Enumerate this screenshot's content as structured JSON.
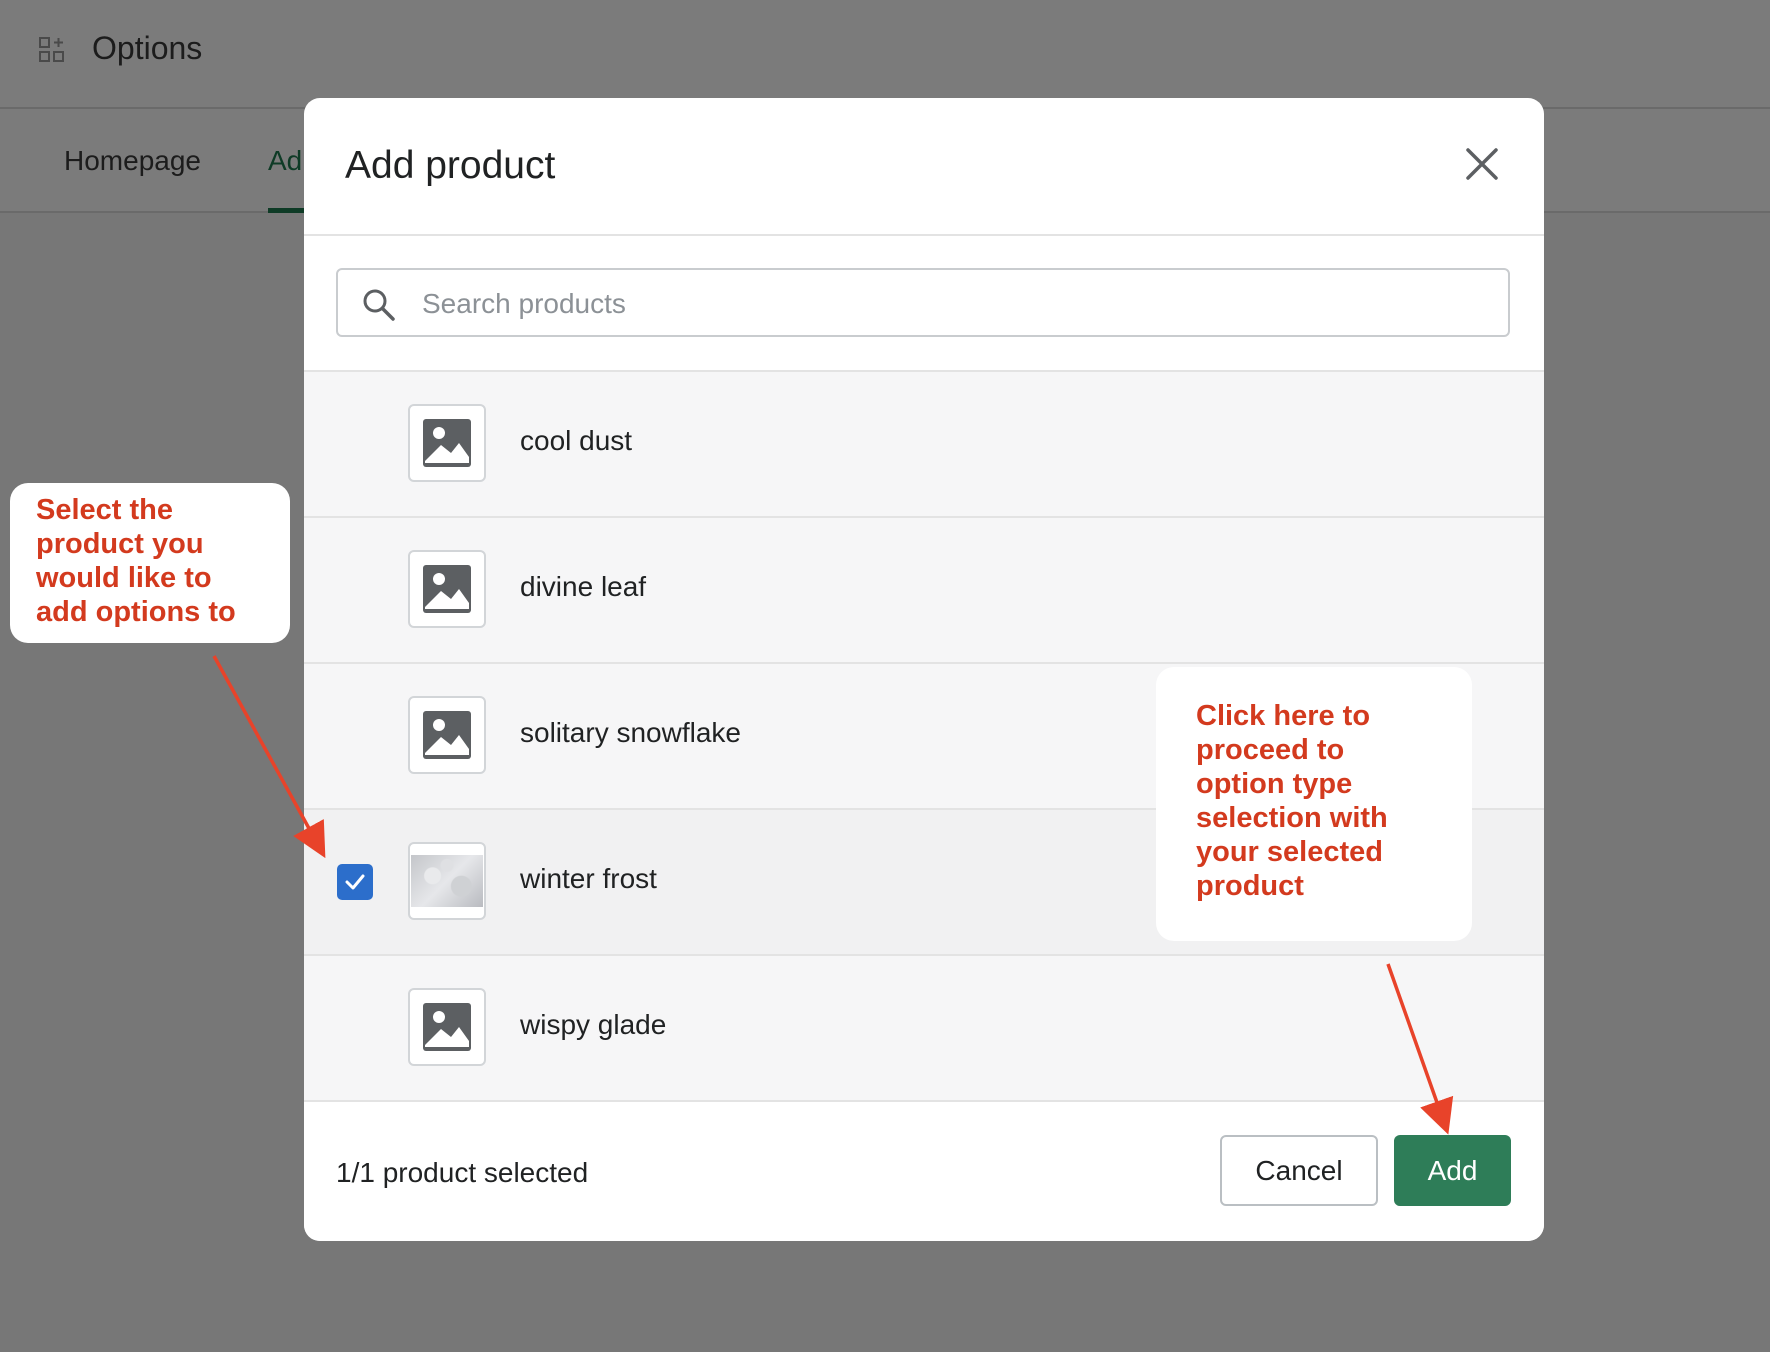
{
  "app": {
    "title": "Options",
    "icon": "apps-add-icon",
    "tabs": [
      {
        "label": "Homepage"
      },
      {
        "label": "Ad"
      }
    ]
  },
  "modal": {
    "title": "Add product",
    "search": {
      "placeholder": "Search products",
      "value": ""
    },
    "products": [
      {
        "name": "cool dust",
        "selected": false,
        "thumbnail": "image-placeholder-icon"
      },
      {
        "name": "divine leaf",
        "selected": false,
        "thumbnail": "image-placeholder-icon"
      },
      {
        "name": "solitary snowflake",
        "selected": false,
        "thumbnail": "image-placeholder-icon"
      },
      {
        "name": "winter frost",
        "selected": true,
        "thumbnail": "photo"
      },
      {
        "name": "wispy glade",
        "selected": false,
        "thumbnail": "image-placeholder-icon"
      }
    ],
    "footer": {
      "status": "1/1 product selected",
      "cancel_label": "Cancel",
      "add_label": "Add"
    }
  },
  "annotations": {
    "select_hint": "Select the product you would like to add options to",
    "add_hint": "Click here to proceed to option type selection with your selected product"
  },
  "colors": {
    "primary_button": "#2e7d58",
    "checkbox": "#2c6ecb",
    "annotation_text": "#d33a1e",
    "overlay": "#777777"
  }
}
